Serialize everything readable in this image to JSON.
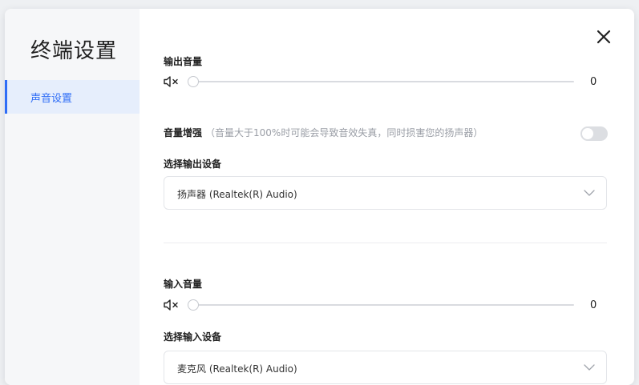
{
  "sidebar": {
    "title": "终端设置",
    "items": [
      {
        "label": "声音设置",
        "active": true
      }
    ]
  },
  "output": {
    "label": "输出音量",
    "volume_icon": "speaker-muted-icon",
    "value": "0",
    "boost_label": "音量增强",
    "boost_desc": "（音量大于100%时可能会导致音效失真，同时损害您的扬声器）",
    "boost_enabled": false,
    "device_label": "选择输出设备",
    "device_value": "扬声器 (Realtek(R) Audio)"
  },
  "input": {
    "label": "输入音量",
    "volume_icon": "speaker-muted-icon",
    "value": "0",
    "device_label": "选择输入设备",
    "device_value": "麦克风 (Realtek(R) Audio)"
  },
  "colors": {
    "accent": "#2f6df6",
    "sidebar_bg": "#f6f7f9",
    "active_bg": "#e6eefc",
    "muted_text": "#9a9ea6"
  },
  "icons": {
    "close": "close-icon",
    "chevron": "chevron-down-icon"
  }
}
